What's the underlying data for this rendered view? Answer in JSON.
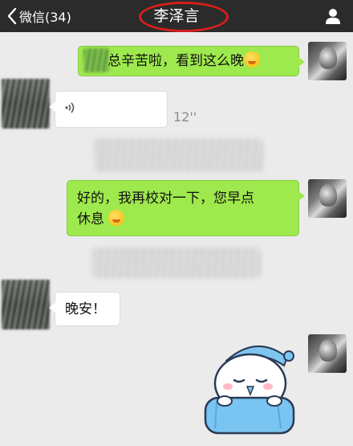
{
  "nav": {
    "back_label": "微信(34)",
    "title": "李泽言"
  },
  "messages": {
    "m1": {
      "text": "总辛苦啦，看到这么晚"
    },
    "m2": {
      "duration": "12''"
    },
    "m3": {
      "line1": "好的，我再校对一下，您早点",
      "line2": "休息"
    },
    "m4": {
      "text": "晚安！"
    }
  },
  "colors": {
    "nav_bg": "#2b2b2b",
    "chat_bg": "#ebebeb",
    "sent_bubble": "#9ee94d",
    "received_bubble": "#ffffff",
    "title_highlight": "#d81e1e"
  }
}
